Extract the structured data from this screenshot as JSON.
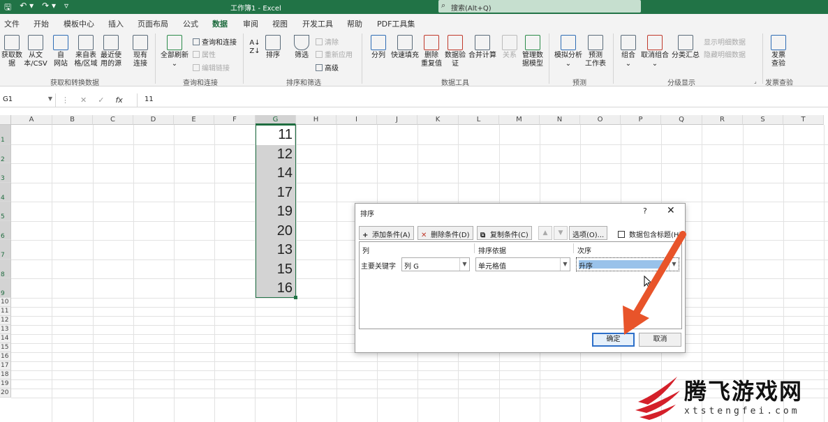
{
  "titlebar": {
    "title": "工作簿1  -  Excel",
    "search_placeholder": "搜索(Alt+Q)",
    "save_icon": "save-icon",
    "undo_icon": "undo-icon",
    "redo_icon": "redo-icon"
  },
  "tabs": [
    "文件",
    "开始",
    "模板中心",
    "插入",
    "页面布局",
    "公式",
    "数据",
    "审阅",
    "视图",
    "开发工具",
    "帮助",
    "PDF工具集"
  ],
  "active_tab": "数据",
  "ribbon": {
    "get_data": {
      "buttons": [
        "获取数\n据",
        "从文\n本/CSV",
        "自\n网站",
        "来自表\n格/区域",
        "最近使\n用的源",
        "现有\n连接"
      ],
      "label": "获取和转换数据"
    },
    "queries": {
      "refresh": "全部刷新",
      "items": [
        "查询和连接",
        "属性",
        "编辑链接"
      ],
      "label": "查询和连接"
    },
    "sort_filter": {
      "sort": "排序",
      "filter": "筛选",
      "items": [
        "清除",
        "重新应用",
        "高级"
      ],
      "label": "排序和筛选"
    },
    "data_tools": {
      "buttons": [
        "分列",
        "快速填充",
        "删除\n重复值",
        "数据验\n证",
        "合并计算",
        "关系",
        "管理数\n据模型"
      ],
      "label": "数据工具"
    },
    "forecast": {
      "buttons": [
        "模拟分析",
        "预测\n工作表"
      ],
      "label": "预测"
    },
    "outline": {
      "buttons": [
        "组合",
        "取消组合",
        "分类汇总"
      ],
      "items": [
        "显示明细数据",
        "隐藏明细数据"
      ],
      "label": "分级显示"
    },
    "invoice": {
      "button": "发票\n查验",
      "label": "发票查验"
    }
  },
  "formula_bar": {
    "name_box": "G1",
    "fx": "fx",
    "content": "11"
  },
  "grid": {
    "columns": [
      "A",
      "B",
      "C",
      "D",
      "E",
      "F",
      "G",
      "H",
      "I",
      "J",
      "K",
      "L",
      "M",
      "N",
      "O",
      "P",
      "Q",
      "R",
      "S",
      "T"
    ],
    "selected_column": "G",
    "rows": [
      "1",
      "2",
      "3",
      "4",
      "5",
      "6",
      "7",
      "8",
      "9",
      "10",
      "11",
      "12",
      "13",
      "14",
      "15",
      "16",
      "17",
      "18",
      "19",
      "20"
    ],
    "g_values": [
      "11",
      "12",
      "14",
      "17",
      "19",
      "20",
      "13",
      "15",
      "16"
    ]
  },
  "sort_dialog": {
    "title": "排序",
    "help": "?",
    "close": "✕",
    "add_condition": "添加条件(A)",
    "delete_condition": "删除条件(D)",
    "copy_condition": "复制条件(C)",
    "options": "选项(O)...",
    "has_headers": "数据包含标题(H)",
    "header_column": "列",
    "header_sort_on": "排序依据",
    "header_order": "次序",
    "row_label": "主要关键字",
    "column_value": "列 G",
    "sort_on_value": "单元格值",
    "order_value": "升序",
    "ok": "确定",
    "cancel": "取消",
    "accent": "#2c6fc9"
  },
  "annotation": {
    "arrow_color": "#e8542a"
  },
  "watermark": {
    "text": "腾飞游戏网",
    "url": "xtstengfei.com"
  }
}
